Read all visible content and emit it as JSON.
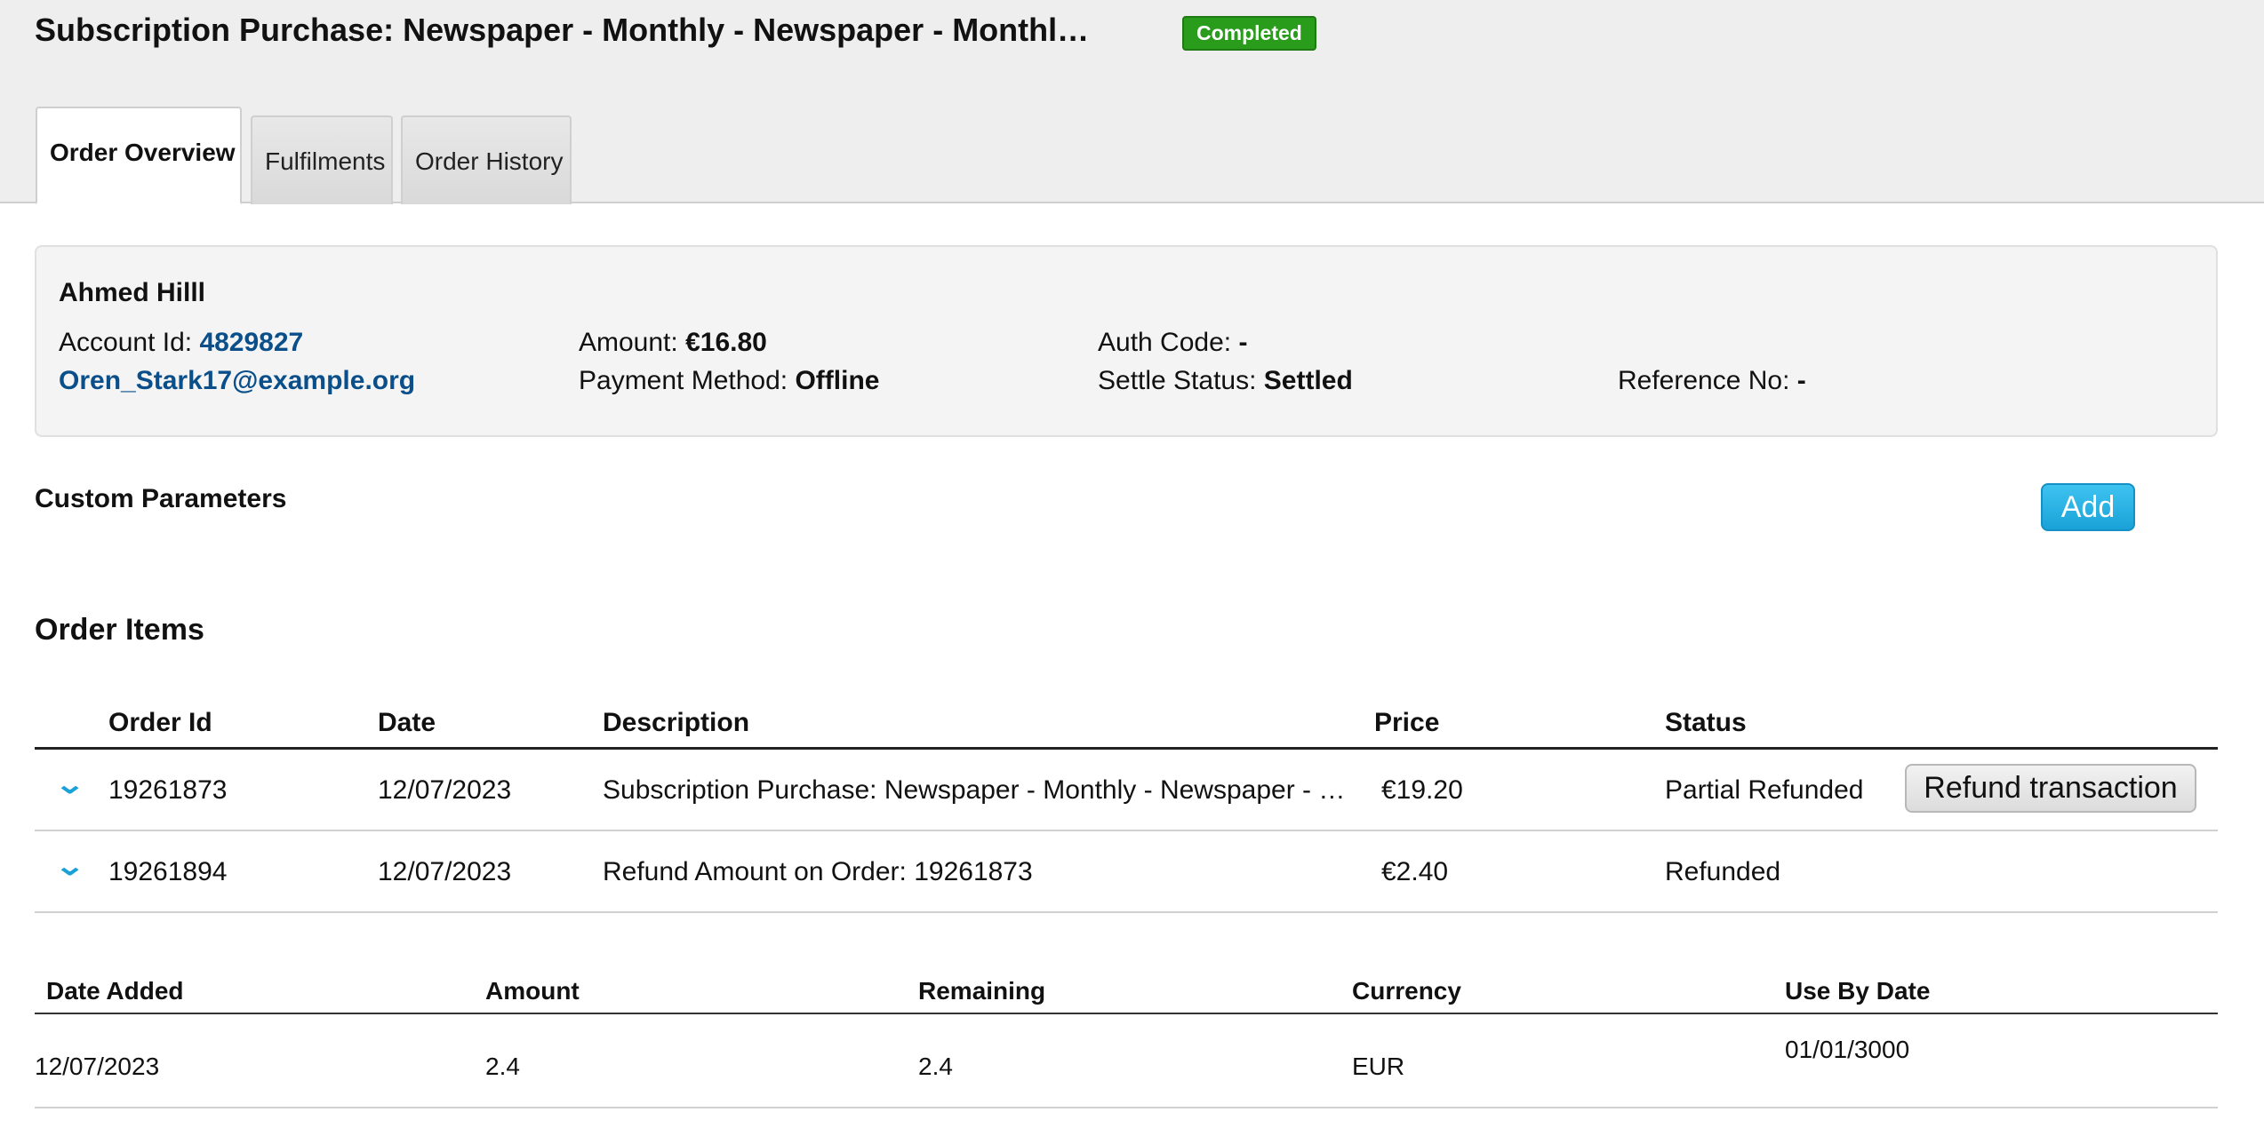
{
  "header": {
    "title": "Subscription Purchase: Newspaper - Monthly - Newspaper - Monthl…",
    "status": "Completed"
  },
  "tabs": [
    {
      "label": "Order Overview",
      "active": true
    },
    {
      "label": "Fulfilments",
      "active": false
    },
    {
      "label": "Order History",
      "active": false
    }
  ],
  "customer": {
    "name": "Ahmed Hilll",
    "account_id_label": "Account Id:",
    "account_id": "4829827",
    "email": "Oren_Stark17@example.org",
    "amount_label": "Amount:",
    "amount": "€16.80",
    "payment_method_label": "Payment Method:",
    "payment_method": "Offline",
    "auth_code_label": "Auth Code:",
    "auth_code": "-",
    "settle_status_label": "Settle Status:",
    "settle_status": "Settled",
    "reference_label": "Reference No:",
    "reference": "-"
  },
  "custom_parameters": {
    "title": "Custom Parameters",
    "add_label": "Add"
  },
  "order_items": {
    "title": "Order Items",
    "columns": [
      "Order Id",
      "Date",
      "Description",
      "Price",
      "Status"
    ],
    "rows": [
      {
        "order_id": "19261873",
        "date": "12/07/2023",
        "description": "Subscription Purchase: Newspaper - Monthly - Newspaper - Monthly",
        "price": "€19.20",
        "status": "Partial Refunded",
        "action": "Refund transaction"
      },
      {
        "order_id": "19261894",
        "date": "12/07/2023",
        "description": "Refund Amount on Order: 19261873",
        "price": "€2.40",
        "status": "Refunded"
      }
    ]
  },
  "credits": {
    "columns": [
      "Date Added",
      "Amount",
      "Remaining",
      "Currency",
      "Use By Date"
    ],
    "rows": [
      {
        "date_added": "12/07/2023",
        "amount": "2.4",
        "remaining": "2.4",
        "currency": "EUR",
        "use_by": "01/01/3000"
      }
    ]
  },
  "colors": {
    "accent": "#1aa2d8",
    "badge_green": "#2a9c1c",
    "link": "#0b4f8a"
  }
}
